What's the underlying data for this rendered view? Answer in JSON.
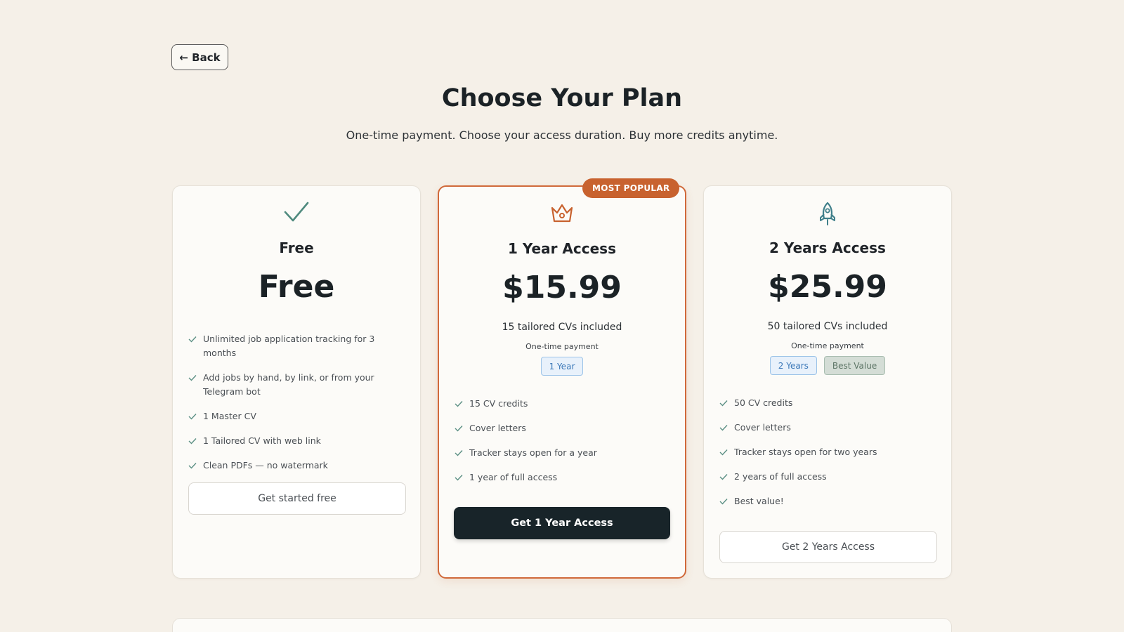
{
  "nav": {
    "back_label": "← Back"
  },
  "header": {
    "title": "Choose Your Plan",
    "subtitle": "One-time payment. Choose your access duration. Buy more credits anytime."
  },
  "colors": {
    "background": "#f5f0e8",
    "accent_orange": "#c8622f",
    "icon_teal": "#4f8a7e",
    "dark_button": "#182429"
  },
  "plans": [
    {
      "icon": "checkmark-icon",
      "name": "Free",
      "price": "Free",
      "features": [
        "Unlimited job application tracking for 3 months",
        "Add jobs by hand, by link, or from your Telegram bot",
        "1 Master CV",
        "1 Tailored CV with web link",
        "Clean PDFs — no watermark"
      ],
      "cta": "Get started free"
    },
    {
      "icon": "crown-icon",
      "badge": "MOST POPULAR",
      "name": "1 Year Access",
      "price": "$15.99",
      "credits": "15 tailored CVs included",
      "payment": "One-time payment",
      "tags": [
        "1 Year"
      ],
      "features": [
        "15 CV credits",
        "Cover letters",
        "Tracker stays open for a year",
        "1 year of full access"
      ],
      "cta": "Get 1 Year Access"
    },
    {
      "icon": "rocket-icon",
      "name": "2 Years Access",
      "price": "$25.99",
      "credits": "50 tailored CVs included",
      "payment": "One-time payment",
      "tags": [
        "2 Years",
        "Best Value"
      ],
      "features": [
        "50 CV credits",
        "Cover letters",
        "Tracker stays open for two years",
        "2 years of full access",
        "Best value!"
      ],
      "cta": "Get 2 Years Access"
    }
  ]
}
